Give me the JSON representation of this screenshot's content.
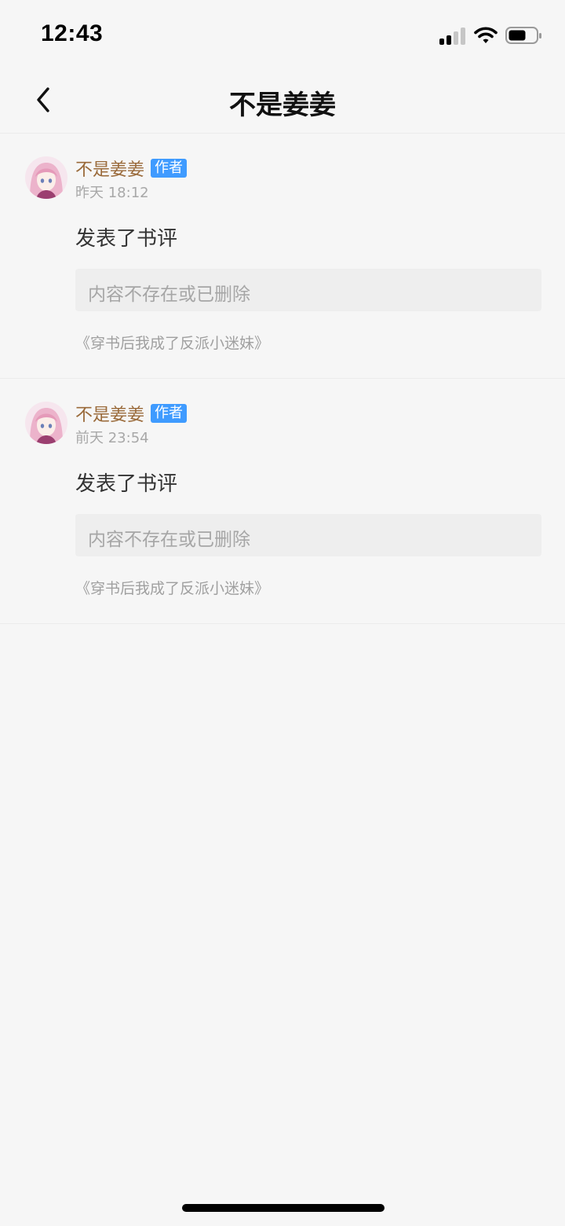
{
  "status_bar": {
    "time": "12:43",
    "icons": [
      "cellular-signal-icon",
      "wifi-icon",
      "battery-icon"
    ]
  },
  "nav": {
    "back_icon": "chevron-left-icon",
    "title": "不是姜姜"
  },
  "feed": [
    {
      "username": "不是姜姜",
      "badge": "作者",
      "time": "昨天 18:12",
      "action": "发表了书评",
      "content": "内容不存在或已删除",
      "book": "《穿书后我成了反派小迷妹》"
    },
    {
      "username": "不是姜姜",
      "badge": "作者",
      "time": "前天 23:54",
      "action": "发表了书评",
      "content": "内容不存在或已删除",
      "book": "《穿书后我成了反派小迷妹》"
    }
  ],
  "colors": {
    "background": "#f6f6f6",
    "username": "#9a6a3a",
    "badge": "#3f9bff",
    "muted_text": "#a6a6a6"
  }
}
